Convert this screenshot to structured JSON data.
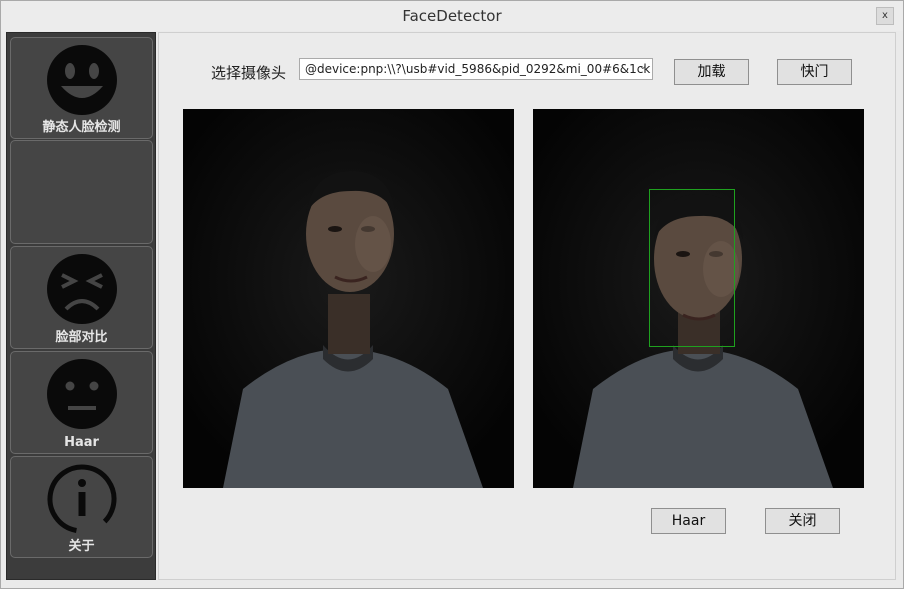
{
  "window": {
    "title": "FaceDetector",
    "close_glyph": "x"
  },
  "sidebar": {
    "items": [
      {
        "label": "静态人脸检测",
        "icon": "smiley-face-icon"
      },
      {
        "label": "",
        "icon": ""
      },
      {
        "label": "脸部对比",
        "icon": "frowning-face-icon"
      },
      {
        "label": "Haar",
        "icon": "neutral-face-icon"
      },
      {
        "label": "关于",
        "icon": "info-icon"
      }
    ]
  },
  "camera": {
    "label": "选择摄像头",
    "selected": "@device:pnp:\\\\?\\usb#vid_5986&pid_0292&mi_00#6&1ck",
    "arrow": "⌄"
  },
  "toolbar": {
    "load_label": "加载",
    "shutter_label": "快门"
  },
  "actions": {
    "haar_label": "Haar",
    "close_label": "关闭"
  },
  "colors": {
    "sidebar_bg": "#3c3c3c",
    "detection_box": "#1fa11f"
  }
}
